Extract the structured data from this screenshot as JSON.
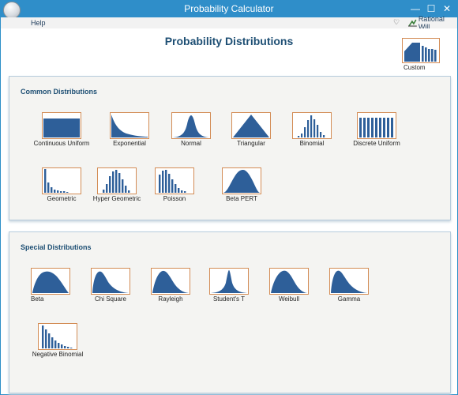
{
  "window": {
    "title": "Probability Calculator"
  },
  "menu": {
    "help": "Help",
    "brand": "Rational Will"
  },
  "icons": {
    "accent": "#2e5f99",
    "thumb_border": "#d38c55"
  },
  "main": {
    "title": "Probability Distributions",
    "custom_label": "Custom"
  },
  "common": {
    "title": "Common Distributions",
    "items": [
      {
        "label": "Continuous Uniform",
        "icon": "continuous-uniform-icon"
      },
      {
        "label": "Exponential",
        "icon": "exponential-icon"
      },
      {
        "label": "Normal",
        "icon": "normal-icon"
      },
      {
        "label": "Triangular",
        "icon": "triangular-icon"
      },
      {
        "label": "Binomial",
        "icon": "binomial-icon"
      },
      {
        "label": "Discrete Uniform",
        "icon": "discrete-uniform-icon"
      },
      {
        "label": "Geometric",
        "icon": "geometric-icon"
      },
      {
        "label": "Hyper Geometric",
        "icon": "hyper-geometric-icon"
      },
      {
        "label": "Poisson",
        "icon": "poisson-icon"
      },
      {
        "label": "Beta PERT",
        "icon": "beta-pert-icon"
      }
    ]
  },
  "special": {
    "title": "Special Distributions",
    "items": [
      {
        "label": "Beta",
        "icon": "beta-icon"
      },
      {
        "label": "Chi Square",
        "icon": "chi-square-icon"
      },
      {
        "label": "Rayleigh",
        "icon": "rayleigh-icon"
      },
      {
        "label": "Student's T",
        "icon": "students-t-icon"
      },
      {
        "label": "Weibull",
        "icon": "weibull-icon"
      },
      {
        "label": "Gamma",
        "icon": "gamma-icon"
      },
      {
        "label": "Negative Binomial",
        "icon": "negative-binomial-icon"
      }
    ]
  }
}
